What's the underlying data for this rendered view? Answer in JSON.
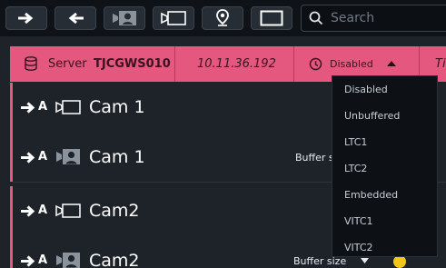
{
  "search": {
    "placeholder": "Search"
  },
  "server": {
    "label": "Server",
    "name": "TJCGWS010",
    "ip": "10.11.36.192",
    "timecode": "Disabled",
    "extra": "Ti"
  },
  "cameras": [
    {
      "letter": "A",
      "name": "Cam 1",
      "icon": "camera-outline-icon"
    },
    {
      "letter": "A",
      "name": "Cam 1",
      "icon": "camera-user-icon",
      "buffer": "Buffer s"
    },
    {
      "letter": "A",
      "name": "Cam2",
      "icon": "camera-outline-icon"
    },
    {
      "letter": "A",
      "name": "Cam2",
      "icon": "camera-user-icon",
      "buffer": "Buffer size"
    }
  ],
  "timecode_options": [
    "Disabled",
    "Unbuffered",
    "LTC1",
    "LTC2",
    "Embedded",
    "VITC1",
    "VITC2"
  ]
}
